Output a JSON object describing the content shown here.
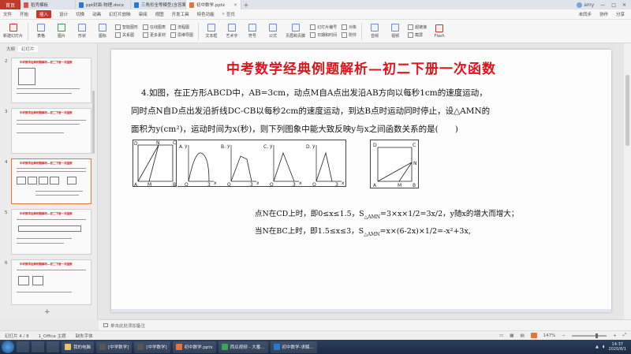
{
  "tabs": {
    "home": "首页",
    "items": [
      {
        "label": "稻壳模板",
        "color": "#d9534f"
      },
      {
        "label": "ppt封面-物理.docx",
        "color": "#2b78d0"
      },
      {
        "label": "三角形全等模型(含答案)",
        "color": "#2b78d0"
      },
      {
        "label": "初中数学.pptx",
        "color": "#e5743d"
      }
    ],
    "user": "amy"
  },
  "menu": {
    "items": [
      "文件",
      "开始",
      "插入",
      "设计",
      "切换",
      "动画",
      "幻灯片放映",
      "审阅",
      "视图",
      "开发工具",
      "特色功能"
    ],
    "active_index": 2,
    "search": "查找",
    "right": [
      "未同步",
      "协作",
      "分享"
    ]
  },
  "ribbon": {
    "buttons": [
      "新建幻灯片",
      "表格",
      "图片",
      "形状",
      "图标",
      "流程图",
      "思维导图",
      "文本框",
      "艺术字",
      "符号",
      "公式",
      "页眉和页脚",
      "日期和时间",
      "附件",
      "音频",
      "视频",
      "Flash"
    ],
    "small": [
      "智能图形",
      "关系图",
      "在线图表",
      "更多素材",
      "幻灯片编号",
      "对象",
      "超链接",
      "截屏"
    ]
  },
  "left_panel": {
    "tabs": [
      "大纲",
      "幻灯片"
    ],
    "slide_numbers": [
      "2",
      "3",
      "4",
      "5",
      "6"
    ],
    "thumb_title": "中考数学经典例题解析—初二下册一次函数",
    "add": "+"
  },
  "slide": {
    "title": "中考数学经典例题解析—初二下册一次函数",
    "question_lines": [
      "4.如图，在正方形ABCD中，AB=3cm，动点M自A点出发沿AB方向以每秒1cm的速度运动，",
      "同时点N自D点出发沿折线DC-CB以每秒2cm的速度运动，到达B点时运动同时停止，设△AMN的",
      "面积为y(cm²)，运动时间为x(秒)，则下列图象中能大致反映y与x之间函数关系的是(　　)"
    ],
    "sol1_pre": "点N在CD上时，即0≤x≤1.5，S",
    "sol1_sub": "△AMN",
    "sol1_post": "=3×x×1/2=3x/2，y随x的增大而增大；",
    "sol2_pre": "当N在BC上时，即1.5≤x≤3，S",
    "sol2_sub": "△AMN",
    "sol2_post": "=x×(6-2x)×1/2=-x²+3x,",
    "fig_main": {
      "D": "D",
      "N": "N",
      "C": "C",
      "A": "A",
      "M": "M",
      "B": "B"
    },
    "fig_options": [
      "A.",
      "B.",
      "C.",
      "D."
    ],
    "fig_axis": {
      "y": "y",
      "x": "x",
      "o": "O",
      "t3": "3"
    },
    "fig_right": {
      "D": "D",
      "C": "C",
      "N": "N",
      "A": "A",
      "M": "M",
      "B": "B"
    }
  },
  "notes": "单击此处添加备注",
  "status": {
    "slide_info": "幻灯片 4 / 8",
    "theme": "1_Office 主题",
    "missing_font": "缺失字体",
    "zoom": "147%"
  },
  "taskbar": {
    "apps": [
      "我的电脑",
      "[中学数学]",
      "[中学数学]",
      "初中数学.pptx",
      "西瓜视频 - 大番...",
      "初中数学-求解..."
    ],
    "time": "14:37",
    "date": "2020/8/1"
  }
}
